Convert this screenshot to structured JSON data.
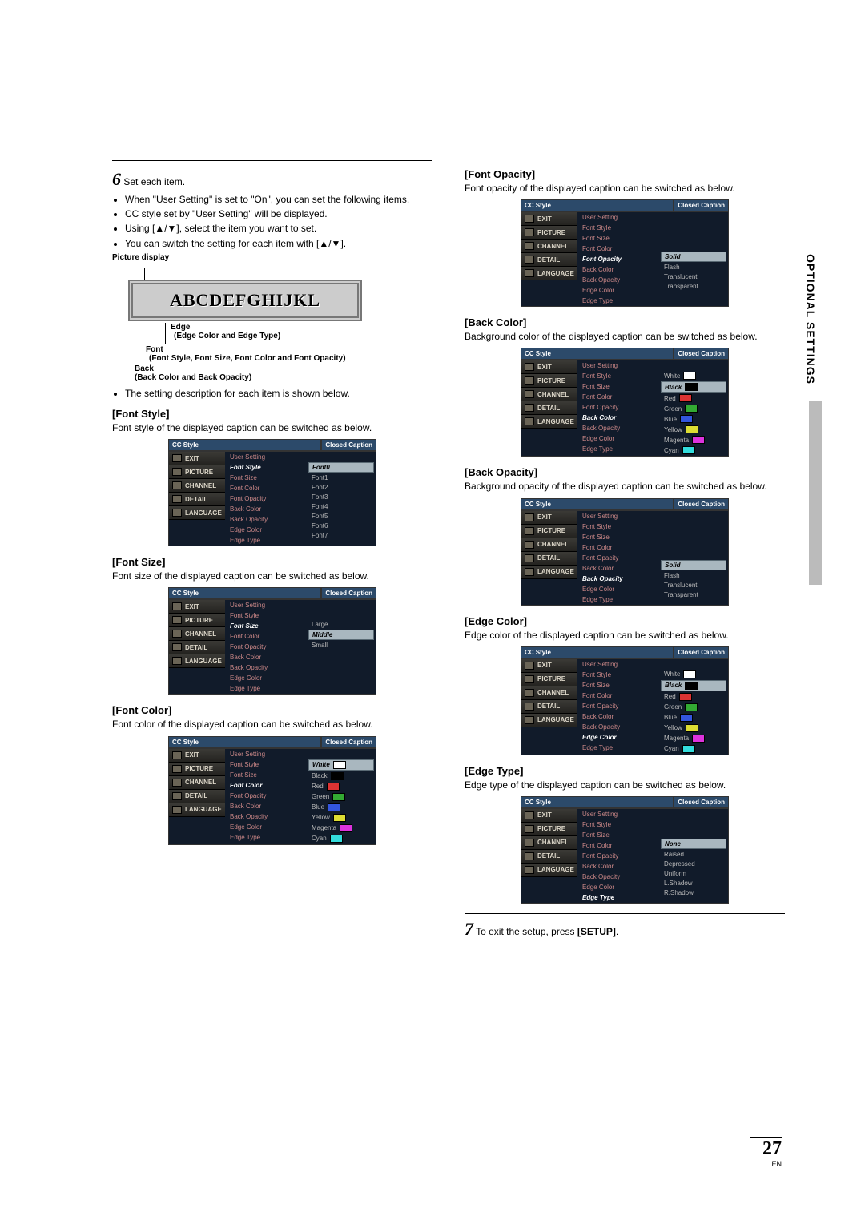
{
  "sideTab": "OPTIONAL SETTINGS",
  "pageNumber": "27",
  "pageLang": "EN",
  "step6": {
    "num": "6",
    "text": "Set each item."
  },
  "step6Bullets": {
    "b1": "When \"User Setting\" is set to \"On\", you can set the following items.",
    "b2": "CC style set by \"User Setting\" will be displayed.",
    "b3": "Using [▲/▼], select the item you want to set.",
    "b4": "You can switch the setting for each item with [▲/▼]."
  },
  "pictureDisplay": {
    "label": "Picture display",
    "sample": "ABCDEFGHIJKL",
    "edge": "Edge",
    "edgeDesc": "(Edge Color and Edge Type)",
    "font": "Font",
    "fontDesc": "(Font Style, Font Size, Font Color and Font Opacity)",
    "back": "Back",
    "backDesc": "(Back Color and Back Opacity)"
  },
  "note": "The setting description for each item is shown below.",
  "osdCommon": {
    "title": "CC Style",
    "ccLabel": "Closed Caption",
    "sideTabs": {
      "exit": "EXIT",
      "picture": "PICTURE",
      "channel": "CHANNEL",
      "detail": "DETAIL",
      "language": "LANGUAGE"
    },
    "rows": {
      "user": "User Setting",
      "style": "Font Style",
      "size": "Font Size",
      "color": "Font Color",
      "opacity": "Font Opacity",
      "bcolor": "Back Color",
      "bopacity": "Back Opacity",
      "ecolor": "Edge Color",
      "etype": "Edge Type"
    }
  },
  "sections": {
    "fontStyle": {
      "head": "[Font Style]",
      "text": "Font style of the displayed caption can be switched as below.",
      "values": [
        "Font0",
        "Font1",
        "Font2",
        "Font3",
        "Font4",
        "Font5",
        "Font6",
        "Font7"
      ],
      "selected": "Font0"
    },
    "fontSize": {
      "head": "[Font Size]",
      "text": "Font size of the displayed caption can be switched as below.",
      "values": [
        "Large",
        "Middle",
        "Small"
      ],
      "selected": "Middle"
    },
    "fontColor": {
      "head": "[Font Color]",
      "text": "Font color of the displayed caption can be switched as below.",
      "values": [
        "White",
        "Black",
        "Red",
        "Green",
        "Blue",
        "Yellow",
        "Magenta",
        "Cyan"
      ],
      "selected": "White",
      "swatches": [
        "#fff",
        "#000",
        "#d33",
        "#3a3",
        "#35d",
        "#dd3",
        "#d3d",
        "#3dd"
      ]
    },
    "fontOpacity": {
      "head": "[Font Opacity]",
      "text": "Font opacity of the displayed caption can be switched as below.",
      "values": [
        "Solid",
        "Flash",
        "Translucent",
        "Transparent"
      ],
      "selected": "Solid"
    },
    "backColor": {
      "head": "[Back Color]",
      "text": "Background color of the displayed caption can be switched as below.",
      "values": [
        "White",
        "Black",
        "Red",
        "Green",
        "Blue",
        "Yellow",
        "Magenta",
        "Cyan"
      ],
      "selected": "Black",
      "swatches": [
        "#fff",
        "#000",
        "#d33",
        "#3a3",
        "#35d",
        "#dd3",
        "#d3d",
        "#3dd"
      ]
    },
    "backOpacity": {
      "head": "[Back Opacity]",
      "text": "Background opacity of the displayed caption can be switched as below.",
      "values": [
        "Solid",
        "Flash",
        "Translucent",
        "Transparent"
      ],
      "selected": "Solid"
    },
    "edgeColor": {
      "head": "[Edge Color]",
      "text": "Edge color of the displayed caption can be switched as below.",
      "values": [
        "White",
        "Black",
        "Red",
        "Green",
        "Blue",
        "Yellow",
        "Magenta",
        "Cyan"
      ],
      "selected": "Black",
      "swatches": [
        "#fff",
        "#000",
        "#d33",
        "#3a3",
        "#35d",
        "#dd3",
        "#d3d",
        "#3dd"
      ]
    },
    "edgeType": {
      "head": "[Edge Type]",
      "text": "Edge type of the displayed caption can be switched as below.",
      "values": [
        "None",
        "Raised",
        "Depressed",
        "Uniform",
        "L.Shadow",
        "R.Shadow"
      ],
      "selected": "None"
    }
  },
  "step7": {
    "num": "7",
    "text": "To exit the setup, press ",
    "bold": "[SETUP]",
    "after": "."
  }
}
